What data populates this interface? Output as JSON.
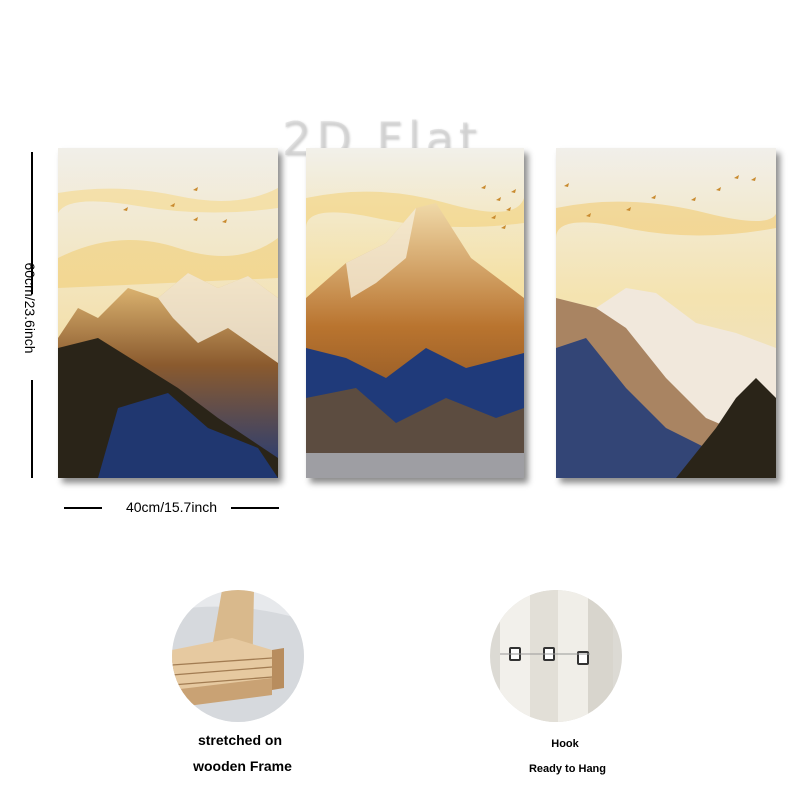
{
  "watermark": "2D Flat",
  "dimensions": {
    "height_label": "60cm/23.6inch",
    "width_label": "40cm/15.7inch"
  },
  "panels": [
    {
      "subject": "mountain-left"
    },
    {
      "subject": "mountain-peak-center"
    },
    {
      "subject": "mountain-right"
    }
  ],
  "features": [
    {
      "icon": "wooden-frame-photo",
      "lines": [
        "stretched on",
        "wooden Frame"
      ]
    },
    {
      "icon": "hook-photo",
      "lines": [
        "Hook",
        "Ready to Hang"
      ]
    }
  ],
  "colors": {
    "gold": "#d9a441",
    "navy": "#1f3a7a",
    "sky": "#ece9e0"
  }
}
